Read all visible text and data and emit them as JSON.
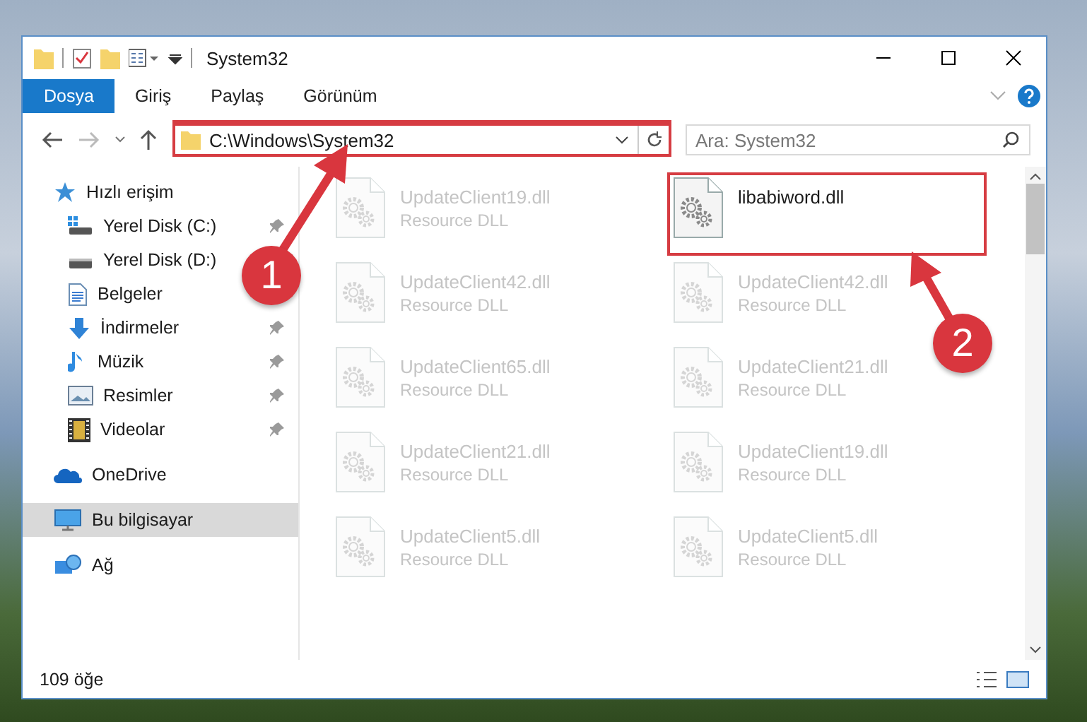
{
  "window": {
    "title": "System32"
  },
  "ribbon_tabs": [
    {
      "label": "Dosya",
      "selected": true
    },
    {
      "label": "Giriş",
      "selected": false
    },
    {
      "label": "Paylaş",
      "selected": false
    },
    {
      "label": "Görünüm",
      "selected": false
    }
  ],
  "address_bar": {
    "path": "C:\\Windows\\System32"
  },
  "search": {
    "placeholder": "Ara: System32"
  },
  "sidebar": {
    "items": [
      {
        "label": "Hızlı erişim",
        "kind": "star",
        "selected": false,
        "children": [
          {
            "label": "Yerel Disk (C:)",
            "kind": "system-drive",
            "pinned": true,
            "selected": false
          },
          {
            "label": "Yerel Disk (D:)",
            "kind": "drive",
            "pinned": false,
            "selected": false
          },
          {
            "label": "Belgeler",
            "kind": "documents",
            "pinned": false,
            "selected": false
          },
          {
            "label": "İndirmeler",
            "kind": "download",
            "pinned": true,
            "selected": false
          },
          {
            "label": "Müzik",
            "kind": "music",
            "pinned": true,
            "selected": false
          },
          {
            "label": "Resimler",
            "kind": "pictures",
            "pinned": true,
            "selected": false
          },
          {
            "label": "Videolar",
            "kind": "videos",
            "pinned": true,
            "selected": false
          }
        ]
      },
      {
        "label": "OneDrive",
        "kind": "cloud",
        "selected": false
      },
      {
        "label": "Bu bilgisayar",
        "kind": "computer",
        "selected": true
      },
      {
        "label": "Ağ",
        "kind": "network",
        "selected": false
      }
    ]
  },
  "files": [
    {
      "name": "UpdateClient19.dll",
      "type": "Resource DLL",
      "faded": true
    },
    {
      "name": "libabiword.dll",
      "faded": false
    },
    {
      "name": "UpdateClient42.dll",
      "type": "Resource DLL",
      "faded": true
    },
    {
      "name": "UpdateClient42.dll",
      "type": "Resource DLL",
      "faded": true
    },
    {
      "name": "UpdateClient65.dll",
      "type": "Resource DLL",
      "faded": true
    },
    {
      "name": "UpdateClient21.dll",
      "type": "Resource DLL",
      "faded": true
    },
    {
      "name": "UpdateClient21.dll",
      "type": "Resource DLL",
      "faded": true
    },
    {
      "name": "UpdateClient19.dll",
      "type": "Resource DLL",
      "faded": true
    },
    {
      "name": "UpdateClient5.dll",
      "type": "Resource DLL",
      "faded": true
    },
    {
      "name": "UpdateClient5.dll",
      "type": "Resource DLL",
      "faded": true
    }
  ],
  "annotations": [
    {
      "label": "1"
    },
    {
      "label": "2"
    }
  ],
  "status_bar": {
    "item_count": "109 öğe"
  }
}
